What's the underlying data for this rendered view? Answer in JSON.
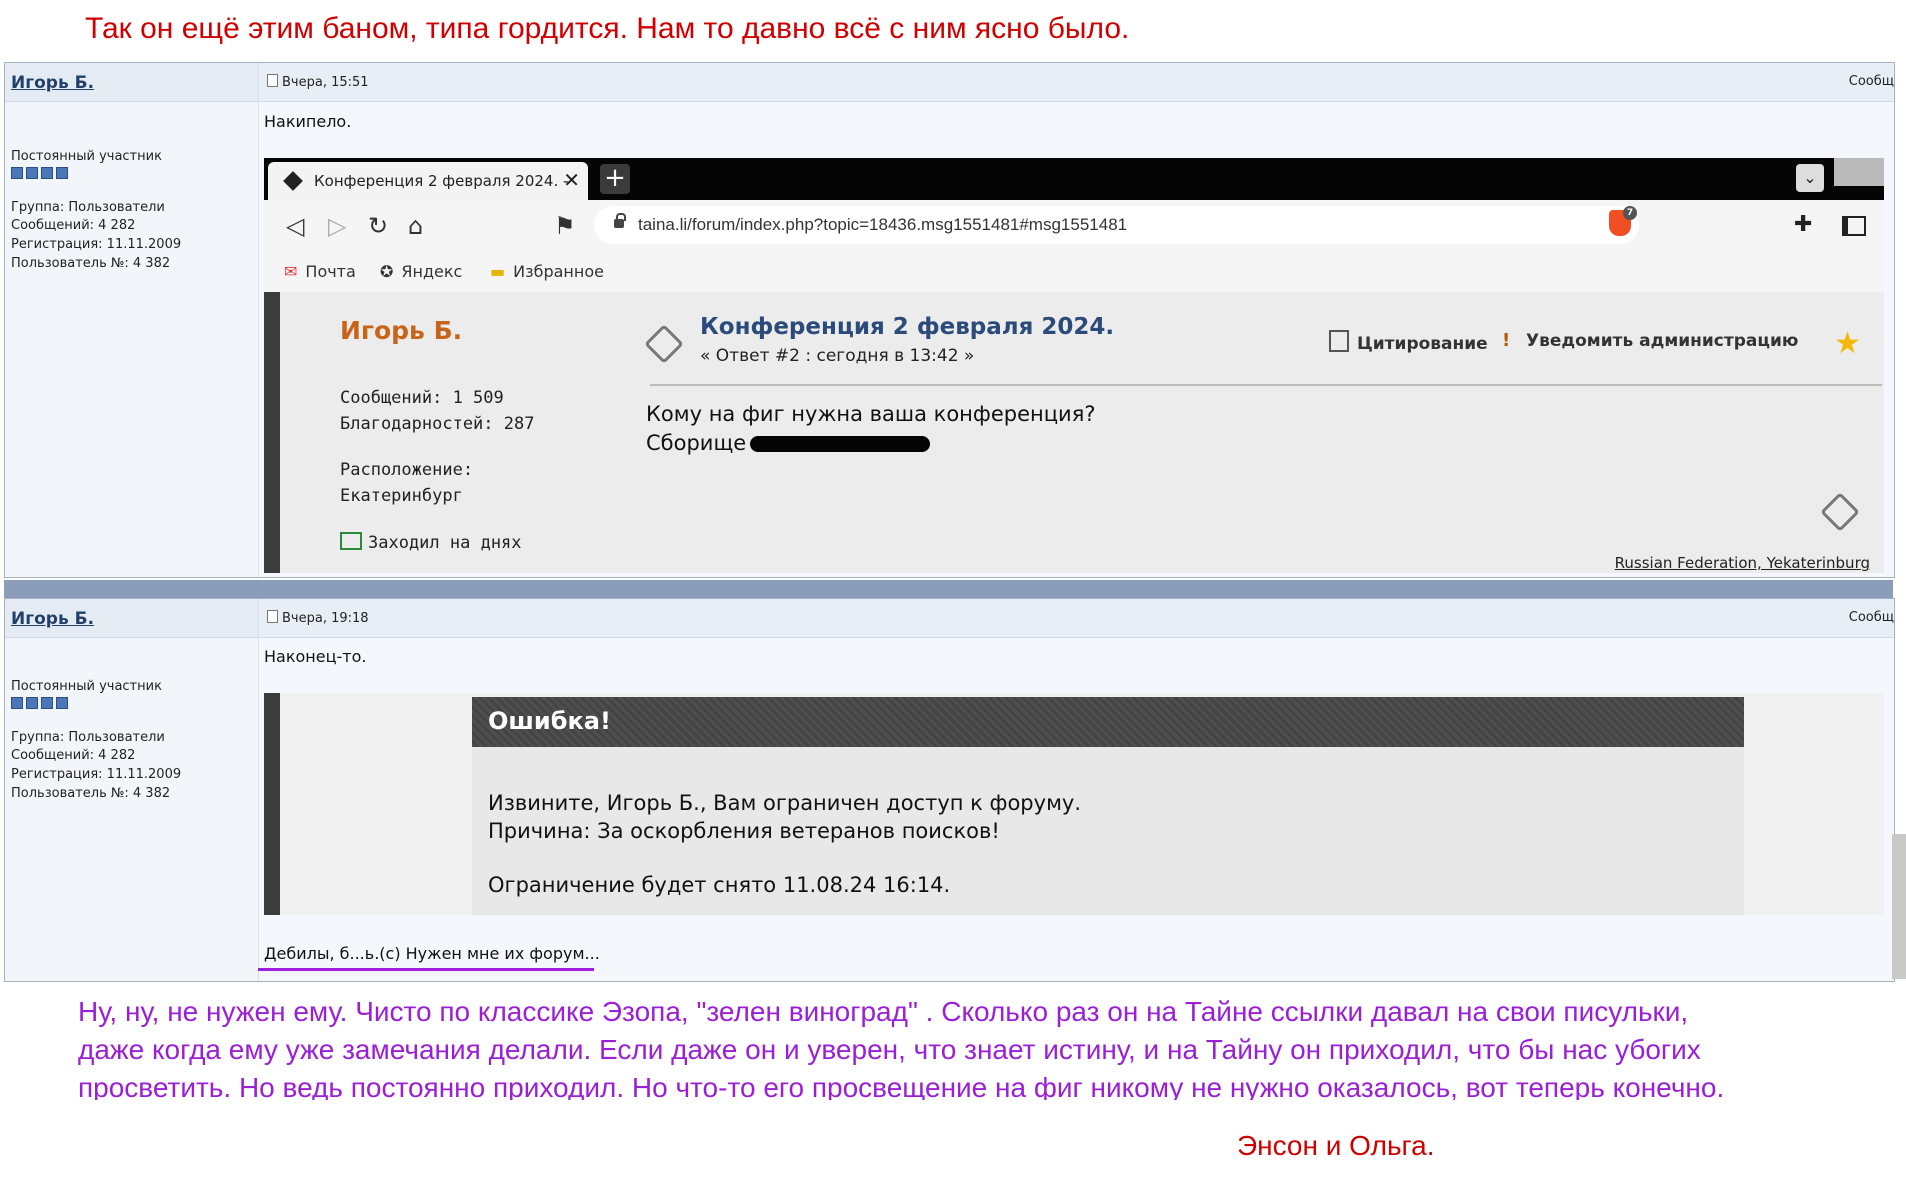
{
  "captions": {
    "top": "Так он ещё этим баном, типа гордится. Нам то давно всё с ним ясно было.",
    "bottom_line1": "Ну, ну, не нужен ему. Чисто по классике Эзопа, \"зелен виноград\" .  Сколько раз он на Тайне ссылки давал на свои писульки,",
    "bottom_line2": "даже когда ему уже замечания делали. Если даже он и уверен, что знает истину, и на Тайну он приходил, что бы нас убогих",
    "bottom_line3": "просветить. Но ведь постоянно приходил. Но что-то его просвещение на фиг никому не нужно оказалось, вот теперь конечно.",
    "signature": "Энсон и Ольга.",
    "colors": {
      "red": "#d00000",
      "purple": "#9b1fd6"
    }
  },
  "posts": [
    {
      "username": "Игорь Б.",
      "rank": "Постоянный участник",
      "group": "Группа: Пользователи",
      "messages": "Сообщений: 4 282",
      "registered": "Регистрация: 11.11.2009",
      "user_no": "Пользователь №: 4 382",
      "date": "Вчера, 15:51",
      "msg_link": "Сообщ",
      "text": "Накипело."
    },
    {
      "username": "Игорь Б.",
      "rank": "Постоянный участник",
      "group": "Группа: Пользователи",
      "messages": "Сообщений: 4 282",
      "registered": "Регистрация: 11.11.2009",
      "user_no": "Пользователь №: 4 382",
      "date": "Вчера, 19:18",
      "msg_link": "Сообщ",
      "text": "Наконец-то.",
      "footer": "Дебилы, б...ь.(с) Нужен мне их форум..."
    }
  ],
  "browser": {
    "tab_title": "Конференция 2 февраля 2024. -",
    "url": "taina.li/forum/index.php?topic=18436.msg1551481#msg1551481",
    "brave_badge": "7",
    "bookmarks": [
      "Почта",
      "Яндекс",
      "Избранное"
    ],
    "author": "Игорь Б.",
    "posts_count": "Сообщений: 1 509",
    "thanks": "Благодарностей: 287",
    "location_label": "Расположение:",
    "location": "Екатеринбург",
    "last_seen": "Заходил на днях",
    "topic": "Конференция 2 февраля 2024.",
    "reply": "« Ответ #2 : сегодня в 13:42 »",
    "quote": "Цитирование",
    "report": "Уведомить администрацию",
    "message_line1": "Кому на фиг нужна ваша конференция?",
    "message_line2": "Сборище",
    "geo": "Russian Federation, Yekaterinburg"
  },
  "error": {
    "title": "Ошибка!",
    "line1": "Извините, Игорь Б., Вам ограничен доступ к форуму.",
    "line2": "Причина: За оскорбления ветеранов поисков!",
    "line3": "Ограничение будет снято 11.08.24 16:14."
  }
}
